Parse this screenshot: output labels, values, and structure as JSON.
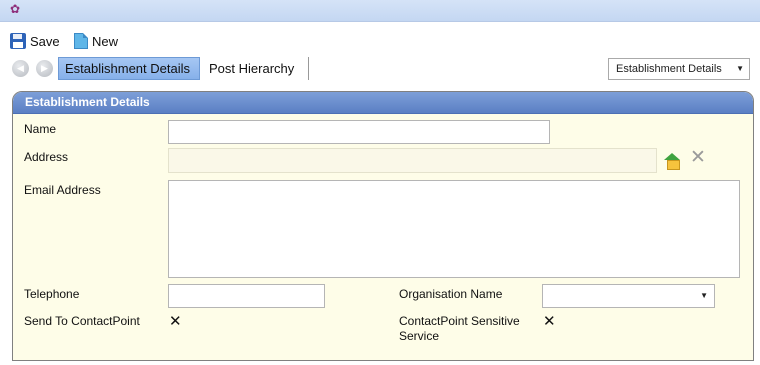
{
  "toolbar": {
    "save_label": "Save",
    "new_label": "New"
  },
  "tabs": {
    "active_label": "Establishment Details",
    "second_label": "Post Hierarchy"
  },
  "view_select": {
    "value": "Establishment Details"
  },
  "panel": {
    "title": "Establishment Details"
  },
  "form": {
    "name_label": "Name",
    "name_value": "",
    "address_label": "Address",
    "address_value": "",
    "email_label": "Email Address",
    "email_value": "",
    "telephone_label": "Telephone",
    "telephone_value": "",
    "org_label": "Organisation Name",
    "org_value": "",
    "send_label": "Send To ContactPoint",
    "send_value": "✕",
    "sensitive_label_1": "ContactPoint Sensitive",
    "sensitive_label_2": "Service",
    "sensitive_value": "✕"
  },
  "icons": {
    "back": "back-arrow-icon",
    "forward": "forward-arrow-icon",
    "house": "house-icon",
    "clear": "close-icon",
    "dropdown": "chevron-down-icon",
    "save": "floppy-disk-icon",
    "new": "new-document-icon"
  },
  "colors": {
    "tab_active": "#86b0ea",
    "panel_header": "#5b7fc4",
    "panel_body": "#fefde8",
    "app_icon": "#8e2e7a"
  }
}
